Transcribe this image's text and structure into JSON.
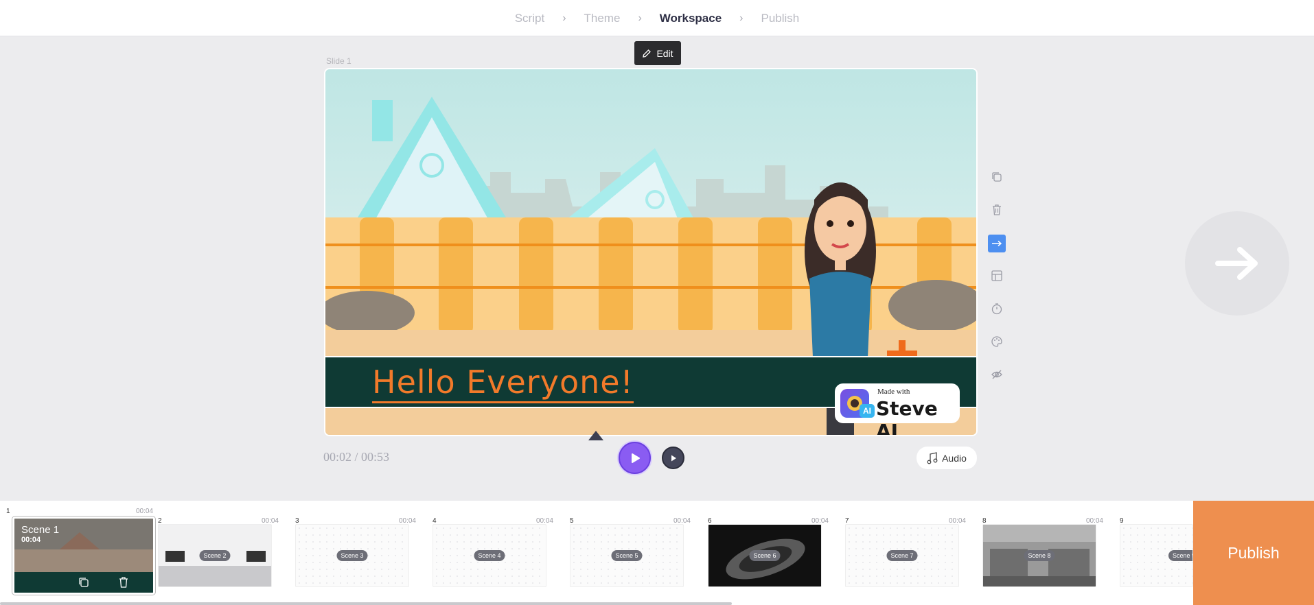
{
  "stepper": {
    "steps": [
      "Script",
      "Theme",
      "Workspace",
      "Publish"
    ],
    "active_index": 2
  },
  "editor": {
    "edit_label": "Edit",
    "slide_label": "Slide 1",
    "caption_text": "Hello Everyone!",
    "watermark_small": "Made with",
    "watermark_big": "Steve AI",
    "watermark_ai": "AI",
    "time_current": "00:02",
    "time_total": "00:53",
    "audio_label": "Audio"
  },
  "side_tools": [
    {
      "name": "duplicate-icon",
      "active": false
    },
    {
      "name": "trash-icon",
      "active": false
    },
    {
      "name": "transition-arrow-icon",
      "active": true
    },
    {
      "name": "layout-icon",
      "active": false
    },
    {
      "name": "timer-icon",
      "active": false
    },
    {
      "name": "palette-icon",
      "active": false
    },
    {
      "name": "eye-hidden-icon",
      "active": false
    }
  ],
  "scenes": [
    {
      "number": "1",
      "label": "Scene 1",
      "duration": "00:04",
      "selected": true
    },
    {
      "number": "2",
      "label": "Scene 2",
      "duration": "00:04",
      "selected": false
    },
    {
      "number": "3",
      "label": "Scene 3",
      "duration": "00:04",
      "selected": false
    },
    {
      "number": "4",
      "label": "Scene 4",
      "duration": "00:04",
      "selected": false
    },
    {
      "number": "5",
      "label": "Scene 5",
      "duration": "00:04",
      "selected": false
    },
    {
      "number": "6",
      "label": "Scene 6",
      "duration": "00:04",
      "selected": false
    },
    {
      "number": "7",
      "label": "Scene 7",
      "duration": "00:04",
      "selected": false
    },
    {
      "number": "8",
      "label": "Scene 8",
      "duration": "00:04",
      "selected": false
    },
    {
      "number": "9",
      "label": "Scene 9",
      "duration": "",
      "selected": false
    }
  ],
  "publish_label": "Publish",
  "colors": {
    "accent_purple": "#8a5cf2",
    "publish_orange": "#ee8f4f",
    "caption_bg": "#0f3a34",
    "caption_text": "#f27a2a",
    "tool_active": "#4d8ff0"
  }
}
